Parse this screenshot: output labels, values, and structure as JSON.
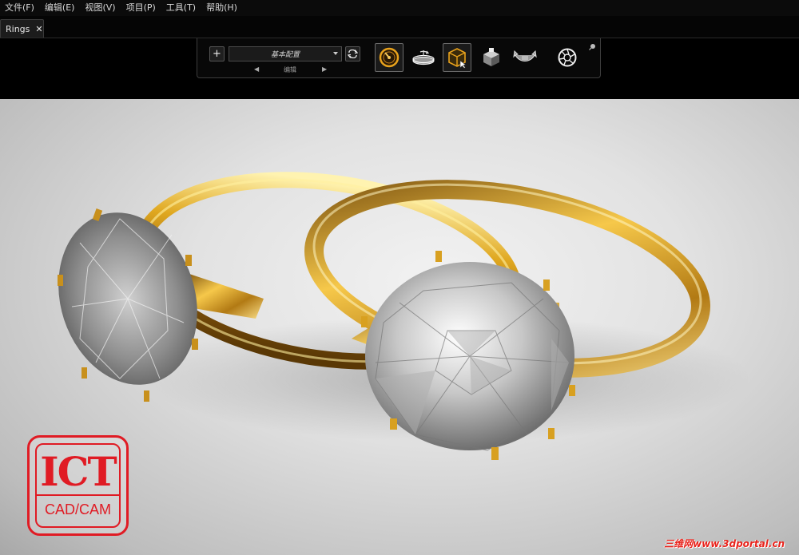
{
  "menu": {
    "items": [
      "文件(F)",
      "编辑(E)",
      "视图(V)",
      "项目(P)",
      "工具(T)",
      "帮助(H)"
    ]
  },
  "tabs": [
    {
      "label": "Rings",
      "close": "✕"
    }
  ],
  "toolbar": {
    "add_label": "+",
    "config_value": "基本配置",
    "edit_label": "编辑",
    "prev_arrow": "◀",
    "next_arrow": "▶",
    "icons": [
      "render-gauge-icon",
      "turntable-icon",
      "select-box-icon",
      "environment-cube-icon",
      "flip-arrows-icon",
      "camera-aperture-icon"
    ],
    "accent_color": "#e8a21c"
  },
  "logo": {
    "top": "ICT",
    "bottom": "CAD/CAM",
    "color": "#e01b24"
  },
  "watermark": "三维网www.3dportal.cn"
}
